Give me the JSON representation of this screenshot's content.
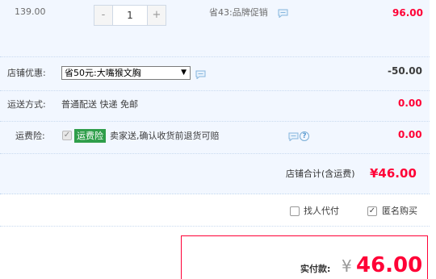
{
  "item": {
    "unit_price": "139.00",
    "quantity": "1",
    "minus_label": "-",
    "plus_label": "+",
    "promo_text": "省43:品牌促销",
    "subtotal": "96.00"
  },
  "store_discount": {
    "label": "店铺优惠:",
    "selected_option": "省50元:大嘴猴文胸",
    "dropdown_arrow": "▼",
    "amount": "-50.00"
  },
  "shipping": {
    "label": "运送方式:",
    "value": "普通配送 快递 免邮",
    "amount": "0.00"
  },
  "insurance": {
    "label": "运费险:",
    "badge": "运费险",
    "text": "卖家送,确认收货前退货可赔",
    "help": "?",
    "amount": "0.00"
  },
  "store_total": {
    "label": "店铺合计(含运费)",
    "amount": "¥46.00"
  },
  "options": {
    "pay_for_me": "找人代付",
    "anonymous": "匿名购买"
  },
  "payment": {
    "label": "实付款:",
    "currency": "¥",
    "amount": "46.00"
  },
  "colors": {
    "accent_red": "#ff0036",
    "panel_blue": "#f2f7ff",
    "badge_green": "#2f9e4a"
  },
  "icons": [
    "message-icon",
    "help-icon",
    "checkbox-icon"
  ]
}
